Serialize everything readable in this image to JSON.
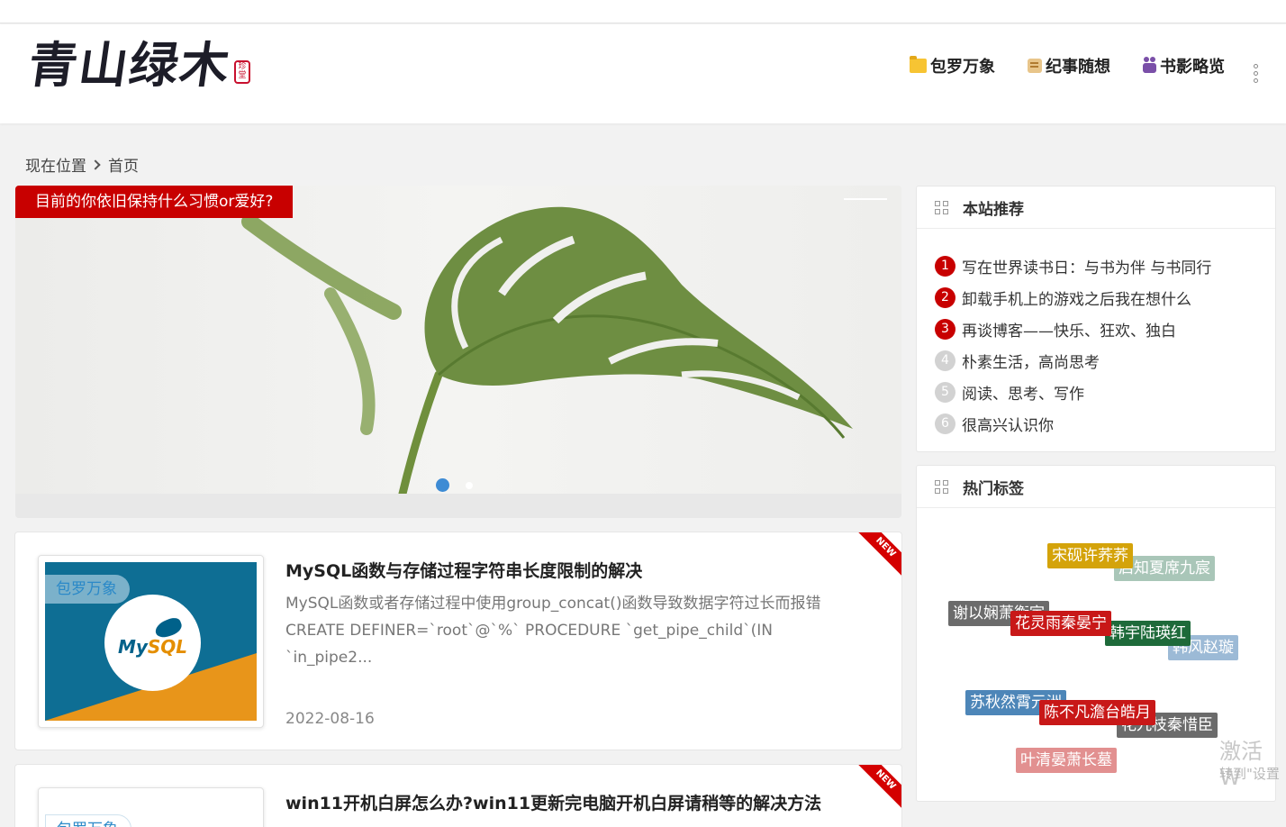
{
  "site": {
    "logo_text": "青山绿木",
    "logo_seal": "珍堂"
  },
  "nav": [
    {
      "label": "包罗万象",
      "icon": "folder-icon"
    },
    {
      "label": "纪事随想",
      "icon": "scroll-icon"
    },
    {
      "label": "书影略览",
      "icon": "camera-icon"
    }
  ],
  "breadcrumb": {
    "location": "现在位置",
    "current": "首页"
  },
  "slider": {
    "caption": "目前的你依旧保持什么习惯or爱好?",
    "active_index": 0,
    "count": 2
  },
  "posts": [
    {
      "title": "MySQL函数与存储过程字符串长度限制的解决",
      "excerpt": "MySQL函数或者存储过程中使用group_concat()函数导致数据字符过长而报错 CREATE DEFINER=`root`@`%` PROCEDURE `get_pipe_child`(IN `in_pipe2...",
      "date": "2022-08-16",
      "category": "包罗万象",
      "ribbon": "NEW",
      "thumb_logo": "MySQL"
    },
    {
      "title": "win11开机白屏怎么办?win11更新完电脑开机白屏请稍等的解决方法",
      "category": "包罗万象",
      "ribbon": "NEW"
    }
  ],
  "recommend": {
    "title": "本站推荐",
    "items": [
      {
        "num": "1",
        "label": "写在世界读书日：与书为伴 与书同行"
      },
      {
        "num": "2",
        "label": "卸载手机上的游戏之后我在想什么"
      },
      {
        "num": "3",
        "label": "再谈博客——快乐、狂欢、独白"
      },
      {
        "num": "4",
        "label": "朴素生活，高尚思考"
      },
      {
        "num": "5",
        "label": "阅读、思考、写作"
      },
      {
        "num": "6",
        "label": "很高兴认识你"
      }
    ]
  },
  "tags": {
    "title": "热门标签",
    "items": [
      {
        "label": "宋砚许荞荞",
        "color": "#d4a30a"
      },
      {
        "label": "启知夏席九宸",
        "color": "#a9c6b8"
      },
      {
        "label": "谢以娴萧衡宇",
        "color": "#6b6b6b"
      },
      {
        "label": "花灵雨秦晏宁",
        "color": "#c81818"
      },
      {
        "label": "韩宇陆瑛红",
        "color": "#1e6a3a"
      },
      {
        "label": "韩风赵璇",
        "color": "#9cbad6"
      },
      {
        "label": "苏秋然霄元洲",
        "color": "#4d86b8"
      },
      {
        "label": "陈不凡澹台皓月",
        "color": "#c81818"
      },
      {
        "label": "花九枝秦惜臣",
        "color": "#6b6b6b"
      },
      {
        "label": "叶清晏萧长墓",
        "color": "#e29090"
      }
    ]
  },
  "watermark": {
    "line1": "激活 W",
    "line2": "转到\"设置"
  }
}
